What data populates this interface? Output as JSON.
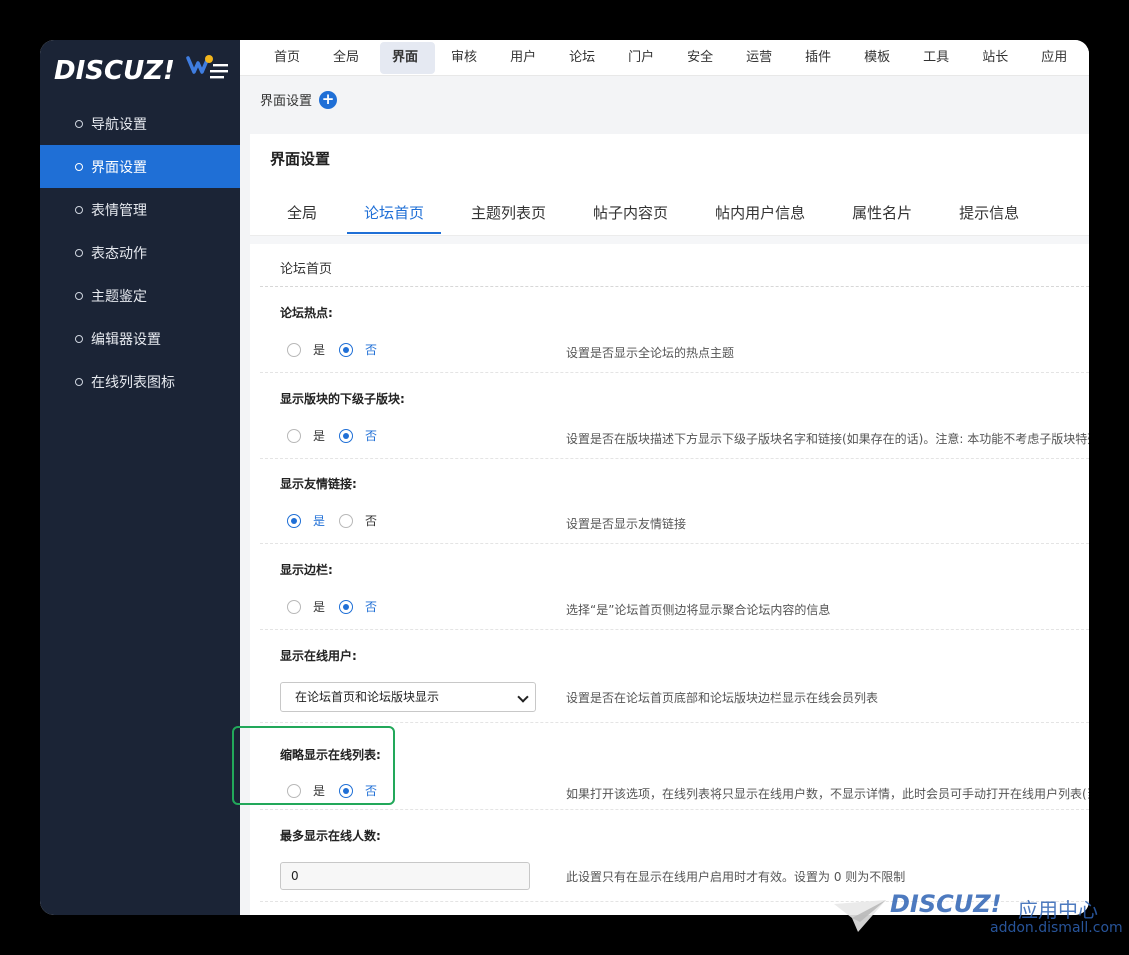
{
  "brand": {
    "logo_text": "DISCUZ!"
  },
  "sidebar": {
    "items": [
      {
        "label": "导航设置",
        "active": false
      },
      {
        "label": "界面设置",
        "active": true
      },
      {
        "label": "表情管理",
        "active": false
      },
      {
        "label": "表态动作",
        "active": false
      },
      {
        "label": "主题鉴定",
        "active": false
      },
      {
        "label": "编辑器设置",
        "active": false
      },
      {
        "label": "在线列表图标",
        "active": false
      }
    ]
  },
  "topnav": {
    "items": [
      "首页",
      "全局",
      "界面",
      "审核",
      "用户",
      "论坛",
      "门户",
      "安全",
      "运营",
      "插件",
      "模板",
      "工具",
      "站长",
      "应用"
    ],
    "active_index": 2
  },
  "breadcrumb": {
    "label": "界面设置",
    "add_icon": "plus-circle-icon"
  },
  "panel": {
    "title": "界面设置",
    "tabs": [
      "全局",
      "论坛首页",
      "主题列表页",
      "帖子内容页",
      "帖内用户信息",
      "属性名片",
      "提示信息"
    ],
    "active_tab": 1,
    "section_title": "论坛首页"
  },
  "settings": {
    "hot": {
      "label": "论坛热点:",
      "yes": "是",
      "no": "否",
      "value": "否",
      "hint": "设置是否显示全论坛的热点主题"
    },
    "subforums": {
      "label": "显示版块的下级子版块:",
      "yes": "是",
      "no": "否",
      "value": "否",
      "hint": "设置是否在版块描述下方显示下级子版块名字和链接(如果存在的话)。注意: 本功能不考虑子版块特殊"
    },
    "links": {
      "label": "显示友情链接:",
      "yes": "是",
      "no": "否",
      "value": "是",
      "hint": "设置是否显示友情链接"
    },
    "sidebar": {
      "label": "显示边栏:",
      "yes": "是",
      "no": "否",
      "value": "否",
      "hint": "选择“是”论坛首页侧边将显示聚合论坛内容的信息"
    },
    "online_users": {
      "label": "显示在线用户:",
      "selected": "在论坛首页和论坛版块显示",
      "hint": "设置是否在论坛首页底部和论坛版块边栏显示在线会员列表"
    },
    "compact_online": {
      "label": "缩略显示在线列表:",
      "yes": "是",
      "no": "否",
      "value": "否",
      "hint": "如果打开该选项，在线列表将只显示在线用户数，不显示详情，此时会员可手动打开在线用户列表(当"
    },
    "max_online": {
      "label": "最多显示在线人数:",
      "value": "0",
      "hint": "此设置只有在显示在线用户启用时才有效。设置为 0 则为不限制"
    }
  },
  "watermark": {
    "logo": "DISCUZ!",
    "cn": "应用中心",
    "url": "addon.dismall.com"
  },
  "colors": {
    "accent": "#1f6fd6",
    "sidebar_bg": "#1b2436",
    "highlight": "#22a85a"
  }
}
